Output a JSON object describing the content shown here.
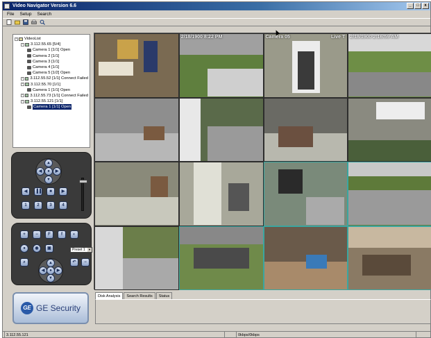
{
  "window": {
    "title": "Video Navigator Version 6.6",
    "controls": [
      "_",
      "□",
      "x"
    ]
  },
  "menu": {
    "items": [
      "File",
      "Setup",
      "Search"
    ]
  },
  "toolbar": {
    "icons": [
      "new-icon",
      "open-icon",
      "save-icon",
      "print-icon",
      "zoom-icon"
    ]
  },
  "tree": {
    "items": [
      {
        "label": "VideoList",
        "level": 0,
        "icon": "root"
      },
      {
        "label": "3.112.55.65 [5/4]",
        "level": 1,
        "icon": "dvr"
      },
      {
        "label": "Camera 1 [1/1] Open",
        "level": 2,
        "icon": "cam"
      },
      {
        "label": "Camera 2 [1/1]",
        "level": 2,
        "icon": "cam"
      },
      {
        "label": "Camera 3 [1/1]",
        "level": 2,
        "icon": "cam"
      },
      {
        "label": "Camera 4 [1/1]",
        "level": 2,
        "icon": "cam"
      },
      {
        "label": "Camera 5 [1/2] Open",
        "level": 2,
        "icon": "cam"
      },
      {
        "label": "3.112.55.52 [1/1] Connect Failed",
        "level": 1,
        "icon": "dvr"
      },
      {
        "label": "3.112.55.70 [1/1]",
        "level": 1,
        "icon": "dvr"
      },
      {
        "label": "Camera 1 [1/1] Open",
        "level": 2,
        "icon": "cam"
      },
      {
        "label": "3.112.55.73 [1/1] Connect Failed",
        "level": 1,
        "icon": "dvr"
      },
      {
        "label": "3.112.55.121 [1/1]",
        "level": 1,
        "icon": "dvr"
      },
      {
        "label": "Camera 1 [1/1] Open",
        "level": 2,
        "icon": "cam",
        "selected": true
      }
    ]
  },
  "ptz": {
    "number_buttons": [
      "1",
      "2",
      "3",
      "4"
    ],
    "transport_buttons": [
      "◀",
      "▐▐",
      "■",
      "▶"
    ]
  },
  "controls": {
    "preset_label": "Preset 1"
  },
  "brand": {
    "logo_text": "GE",
    "name": "GE Security"
  },
  "cameras": [
    {
      "label": ""
    },
    {
      "label": "2/18/1900 8:22 PM"
    },
    {
      "label": "Camera 05",
      "extra": "Live T"
    },
    {
      "label": "2/18/1900 2:16:59 AM"
    },
    {
      "label": ""
    },
    {
      "label": ""
    },
    {
      "label": ""
    },
    {
      "label": ""
    },
    {
      "label": ""
    },
    {
      "label": ""
    },
    {
      "label": ""
    },
    {
      "label": ""
    },
    {
      "label": ""
    },
    {
      "label": ""
    },
    {
      "label": ""
    },
    {
      "label": ""
    }
  ],
  "info_tabs": [
    "Disk Analysis",
    "Search Results",
    "Status"
  ],
  "status": {
    "left": "3.112.55.121",
    "right": "0kbps/0kbps"
  }
}
